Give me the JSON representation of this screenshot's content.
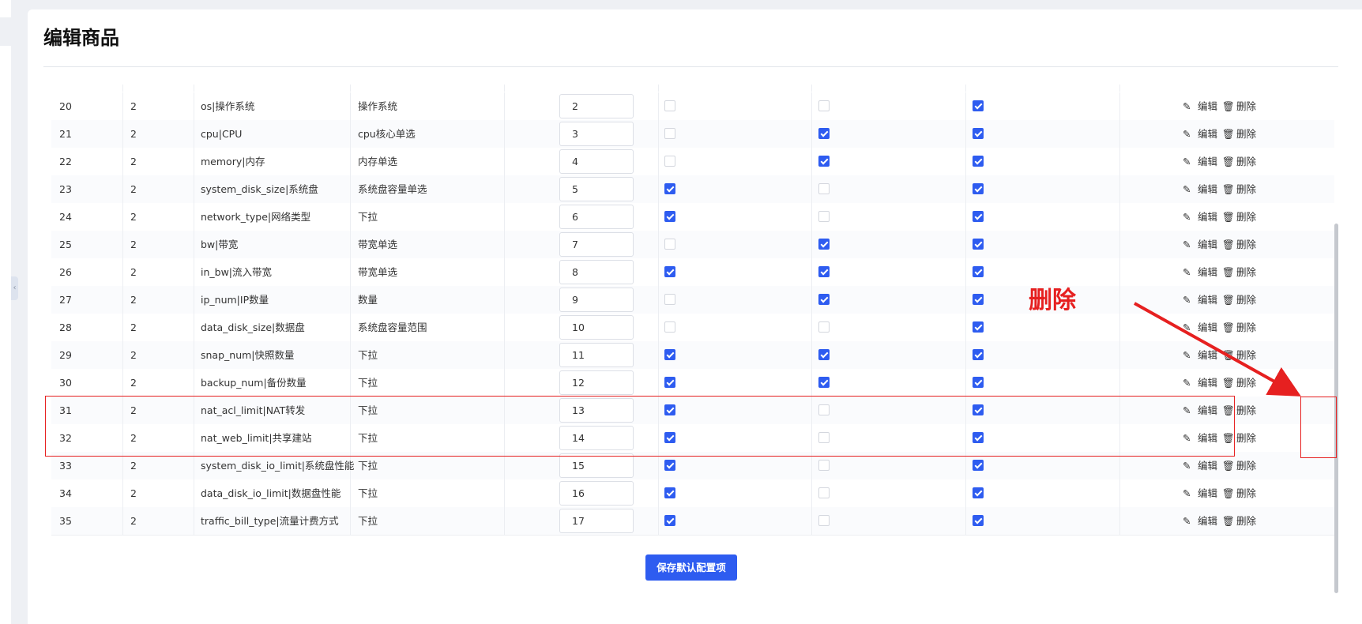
{
  "page": {
    "title": "编辑商品"
  },
  "actions": {
    "edit_label": "编辑",
    "delete_label": "删除"
  },
  "rows": [
    {
      "id": "20",
      "group": "2",
      "name": "os|操作系统",
      "type": "操作系统",
      "order": "2",
      "c1": false,
      "c2": false,
      "c3": true
    },
    {
      "id": "21",
      "group": "2",
      "name": "cpu|CPU",
      "type": "cpu核心单选",
      "order": "3",
      "c1": false,
      "c2": true,
      "c3": true
    },
    {
      "id": "22",
      "group": "2",
      "name": "memory|内存",
      "type": "内存单选",
      "order": "4",
      "c1": false,
      "c2": true,
      "c3": true
    },
    {
      "id": "23",
      "group": "2",
      "name": "system_disk_size|系统盘",
      "type": "系统盘容量单选",
      "order": "5",
      "c1": true,
      "c2": false,
      "c3": true
    },
    {
      "id": "24",
      "group": "2",
      "name": "network_type|网络类型",
      "type": "下拉",
      "order": "6",
      "c1": true,
      "c2": false,
      "c3": true
    },
    {
      "id": "25",
      "group": "2",
      "name": "bw|带宽",
      "type": "带宽单选",
      "order": "7",
      "c1": false,
      "c2": true,
      "c3": true
    },
    {
      "id": "26",
      "group": "2",
      "name": "in_bw|流入带宽",
      "type": "带宽单选",
      "order": "8",
      "c1": true,
      "c2": true,
      "c3": true
    },
    {
      "id": "27",
      "group": "2",
      "name": "ip_num|IP数量",
      "type": "数量",
      "order": "9",
      "c1": false,
      "c2": true,
      "c3": true
    },
    {
      "id": "28",
      "group": "2",
      "name": "data_disk_size|数据盘",
      "type": "系统盘容量范围",
      "order": "10",
      "c1": false,
      "c2": false,
      "c3": true
    },
    {
      "id": "29",
      "group": "2",
      "name": "snap_num|快照数量",
      "type": "下拉",
      "order": "11",
      "c1": true,
      "c2": true,
      "c3": true
    },
    {
      "id": "30",
      "group": "2",
      "name": "backup_num|备份数量",
      "type": "下拉",
      "order": "12",
      "c1": true,
      "c2": true,
      "c3": true
    },
    {
      "id": "31",
      "group": "2",
      "name": "nat_acl_limit|NAT转发",
      "type": "下拉",
      "order": "13",
      "c1": true,
      "c2": false,
      "c3": true
    },
    {
      "id": "32",
      "group": "2",
      "name": "nat_web_limit|共享建站",
      "type": "下拉",
      "order": "14",
      "c1": true,
      "c2": false,
      "c3": true
    },
    {
      "id": "33",
      "group": "2",
      "name": "system_disk_io_limit|系统盘性能",
      "type": "下拉",
      "order": "15",
      "c1": true,
      "c2": false,
      "c3": true
    },
    {
      "id": "34",
      "group": "2",
      "name": "data_disk_io_limit|数据盘性能",
      "type": "下拉",
      "order": "16",
      "c1": true,
      "c2": false,
      "c3": true
    },
    {
      "id": "35",
      "group": "2",
      "name": "traffic_bill_type|流量计费方式",
      "type": "下拉",
      "order": "17",
      "c1": true,
      "c2": false,
      "c3": true
    }
  ],
  "footer": {
    "save_label": "保存默认配置项"
  },
  "annotation": {
    "text": "删除",
    "color": "#e62020"
  },
  "colors": {
    "primary": "#2e5cf0",
    "danger": "#e5566b"
  }
}
